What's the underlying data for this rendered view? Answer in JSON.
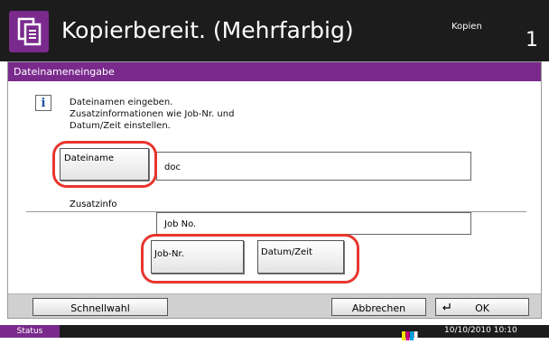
{
  "header": {
    "title": "Kopierbereit. (Mehrfarbig)",
    "mode_label": "Kopien",
    "copy_count": "1",
    "app_icon": "copy-documents-icon"
  },
  "panel": {
    "title": "Dateinameneingabe",
    "info_icon": "info-icon",
    "info_lines": [
      "Dateinamen eingeben.",
      "Zusatzinformationen wie Job-Nr. und",
      "Datum/Zeit einstellen."
    ],
    "filename_button_label": "Dateiname",
    "filename_value": "doc",
    "zusatzinfo_label": "Zusatzinfo",
    "zusatzinfo_value": "Job No.",
    "job_nr_button_label": "Job-Nr.",
    "datum_zeit_button_label": "Datum/Zeit"
  },
  "footer": {
    "quick_setup_label": "Schnellwahl",
    "cancel_label": "Abbrechen",
    "ok_label": "OK",
    "ok_icon": "enter-return-icon"
  },
  "status_bar": {
    "status_label": "Status",
    "datetime": "10/10/2010  10:10",
    "toner_icon": "toner-level-icon"
  },
  "colors": {
    "accent": "#7a2a8c",
    "header_bg": "#1c1c1c",
    "highlight": "#e8362f"
  }
}
